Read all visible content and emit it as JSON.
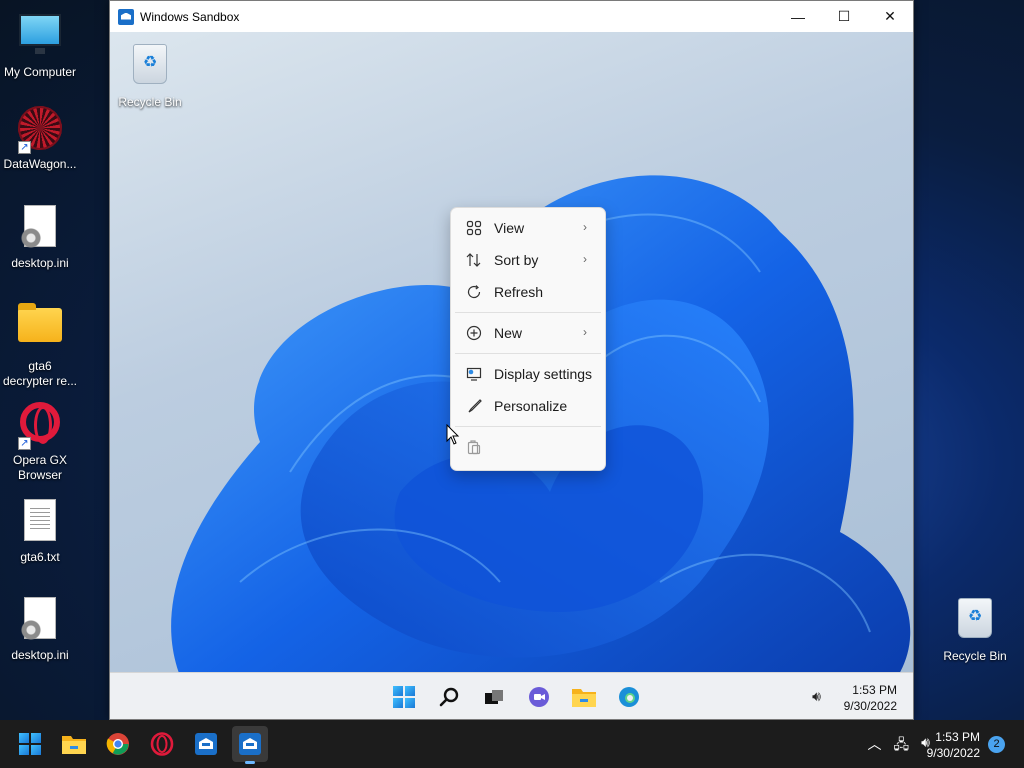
{
  "host_desktop": {
    "icons": [
      {
        "label": "My Computer"
      },
      {
        "label": "DataWagon..."
      },
      {
        "label": "desktop.ini"
      },
      {
        "label": "gta6\ndecrypter re..."
      },
      {
        "label": "Opera GX\nBrowser"
      },
      {
        "label": "gta6.txt"
      },
      {
        "label": "desktop.ini"
      },
      {
        "label": "Recycle Bin"
      }
    ]
  },
  "sandbox_window": {
    "title": "Windows Sandbox",
    "controls": {
      "minimize": "—",
      "maximize": "☐",
      "close": "✕"
    },
    "desktop_icons": [
      {
        "label": "Recycle Bin"
      }
    ],
    "context_menu": {
      "items": [
        {
          "label": "View",
          "icon": "view-grid-icon",
          "submenu": true
        },
        {
          "label": "Sort by",
          "icon": "sort-icon",
          "submenu": true
        },
        {
          "label": "Refresh",
          "icon": "refresh-icon",
          "submenu": false
        },
        {
          "label": "New",
          "icon": "new-plus-icon",
          "submenu": true
        },
        {
          "label": "Display settings",
          "icon": "display-settings-icon",
          "submenu": false
        },
        {
          "label": "Personalize",
          "icon": "personalize-brush-icon",
          "submenu": false
        }
      ],
      "chevron": "›"
    },
    "taskbar": {
      "time": "1:53 PM",
      "date": "9/30/2022"
    }
  },
  "host_taskbar": {
    "time": "1:53 PM",
    "date": "9/30/2022",
    "notification_count": "2"
  }
}
